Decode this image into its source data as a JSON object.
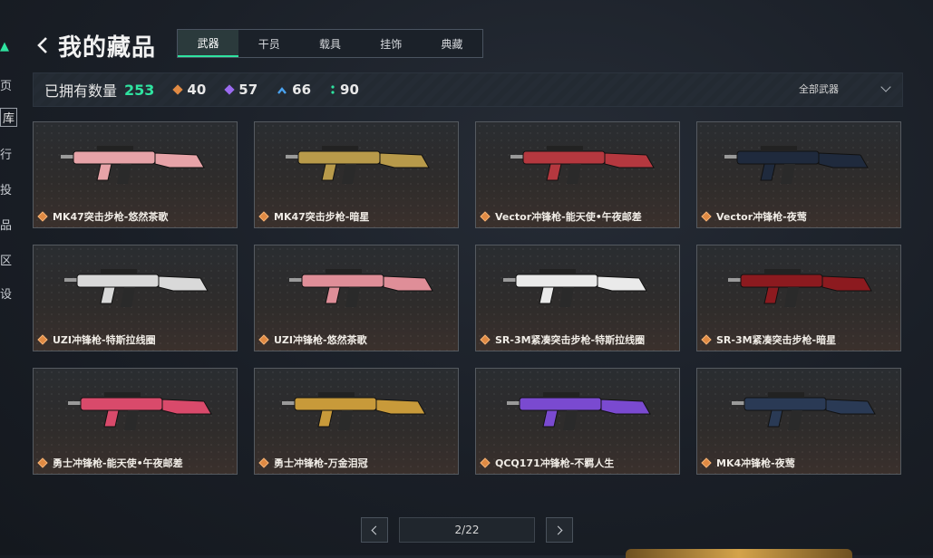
{
  "sidebar": {
    "items": [
      "页",
      "库",
      "行",
      "投",
      "品",
      "区",
      "设"
    ]
  },
  "header": {
    "title": "我的藏品"
  },
  "tabs": [
    "武器",
    "干员",
    "载具",
    "挂饰",
    "典藏"
  ],
  "stats": {
    "owned_label": "已拥有数量",
    "owned_count": "253",
    "rarities": [
      {
        "icon": "orange-diamond-icon",
        "color": "#e08a43",
        "value": "40"
      },
      {
        "icon": "purple-diamond-icon",
        "color": "#9b6bf0",
        "value": "57"
      },
      {
        "icon": "blue-chevron-icon",
        "color": "#4aa3f0",
        "value": "66"
      },
      {
        "icon": "green-dots-icon",
        "color": "#2fe3a0",
        "value": "90"
      }
    ],
    "filter_label": "全部武器"
  },
  "items": [
    {
      "name": "MK47突击步枪-悠然茶歌",
      "color": "#e7a3a8"
    },
    {
      "name": "MK47突击步枪-暗星",
      "color": "#b89a4a"
    },
    {
      "name": "Vector冲锋枪-能天使•午夜邮差",
      "color": "#b5383f"
    },
    {
      "name": "Vector冲锋枪-夜莺",
      "color": "#1f2a3d"
    },
    {
      "name": "UZI冲锋枪-特斯拉线圈",
      "color": "#d9d9d9"
    },
    {
      "name": "UZI冲锋枪-悠然茶歌",
      "color": "#df8e98"
    },
    {
      "name": "SR-3M紧凑突击步枪-特斯拉线圈",
      "color": "#eaeaea"
    },
    {
      "name": "SR-3M紧凑突击步枪-暗星",
      "color": "#8c1a1f"
    },
    {
      "name": "勇士冲锋枪-能天使•午夜邮差",
      "color": "#d94a6b"
    },
    {
      "name": "勇士冲锋枪-万金泪冠",
      "color": "#c89a3a"
    },
    {
      "name": "QCQ171冲锋枪-不羁人生",
      "color": "#7a4ad0"
    },
    {
      "name": "MK4冲锋枪-夜莺",
      "color": "#2a3a55"
    }
  ],
  "pager": {
    "label": "2/22"
  }
}
